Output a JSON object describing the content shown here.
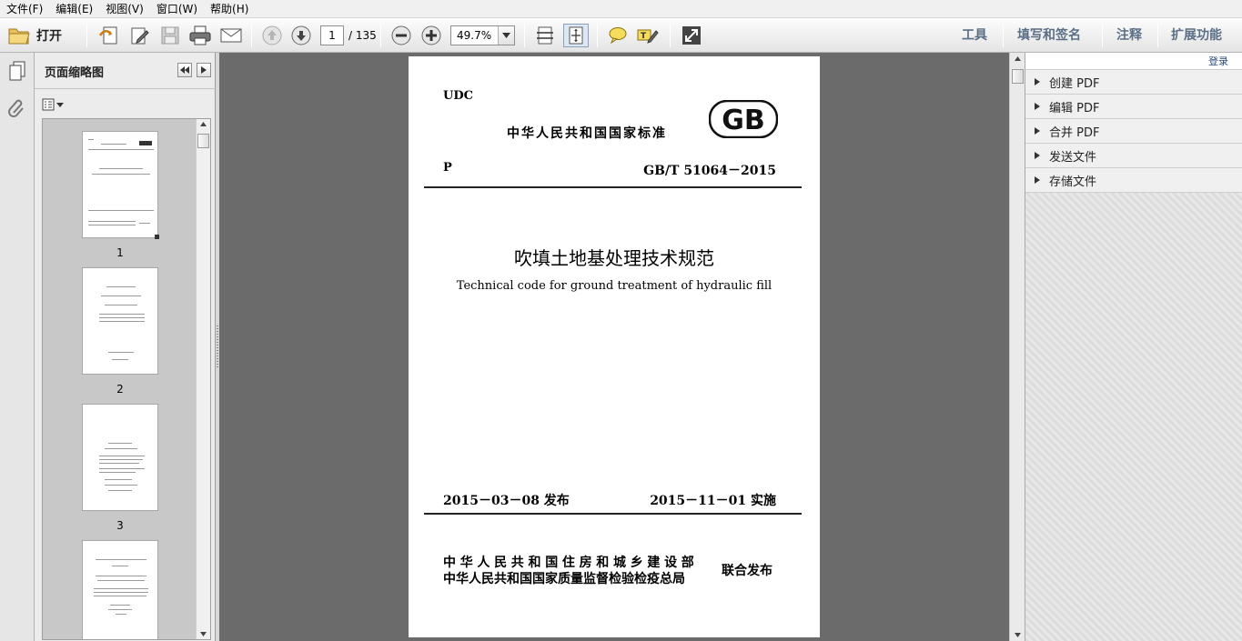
{
  "menu": {
    "file": "文件(F)",
    "edit": "编辑(E)",
    "view": "视图(V)",
    "window": "窗口(W)",
    "help": "帮助(H)"
  },
  "toolbar": {
    "open_label": "打开",
    "current_page": "1",
    "total_pages": "/ 135",
    "zoom": "49.7%",
    "tools_label": "工具",
    "fill_sign_label": "填写和签名",
    "comment_label": "注释",
    "extend_label": "扩展功能"
  },
  "thumbnails": {
    "title": "页面缩略图",
    "pages": [
      {
        "num": "1"
      },
      {
        "num": "2"
      },
      {
        "num": "3"
      }
    ]
  },
  "document": {
    "udc": "UDC",
    "standard_name": "中华人民共和国国家标准",
    "logo": "GB",
    "category": "P",
    "code": "GB/T 51064－2015",
    "title": "吹填土地基处理技术规范",
    "subtitle": "Technical code for ground treatment of hydraulic fill",
    "issue_date": "2015－03－08  发布",
    "impl_date": "2015－11－01  实施",
    "org1": "中华人民共和国住房和城乡建设部",
    "org2": "中华人民共和国国家质量监督检验检疫总局",
    "joint": "联合发布"
  },
  "right_pane": {
    "login": "登录",
    "items": [
      {
        "label": "创建 PDF"
      },
      {
        "label": "编辑 PDF"
      },
      {
        "label": "合并 PDF"
      },
      {
        "label": "发送文件"
      },
      {
        "label": "存储文件"
      }
    ]
  }
}
